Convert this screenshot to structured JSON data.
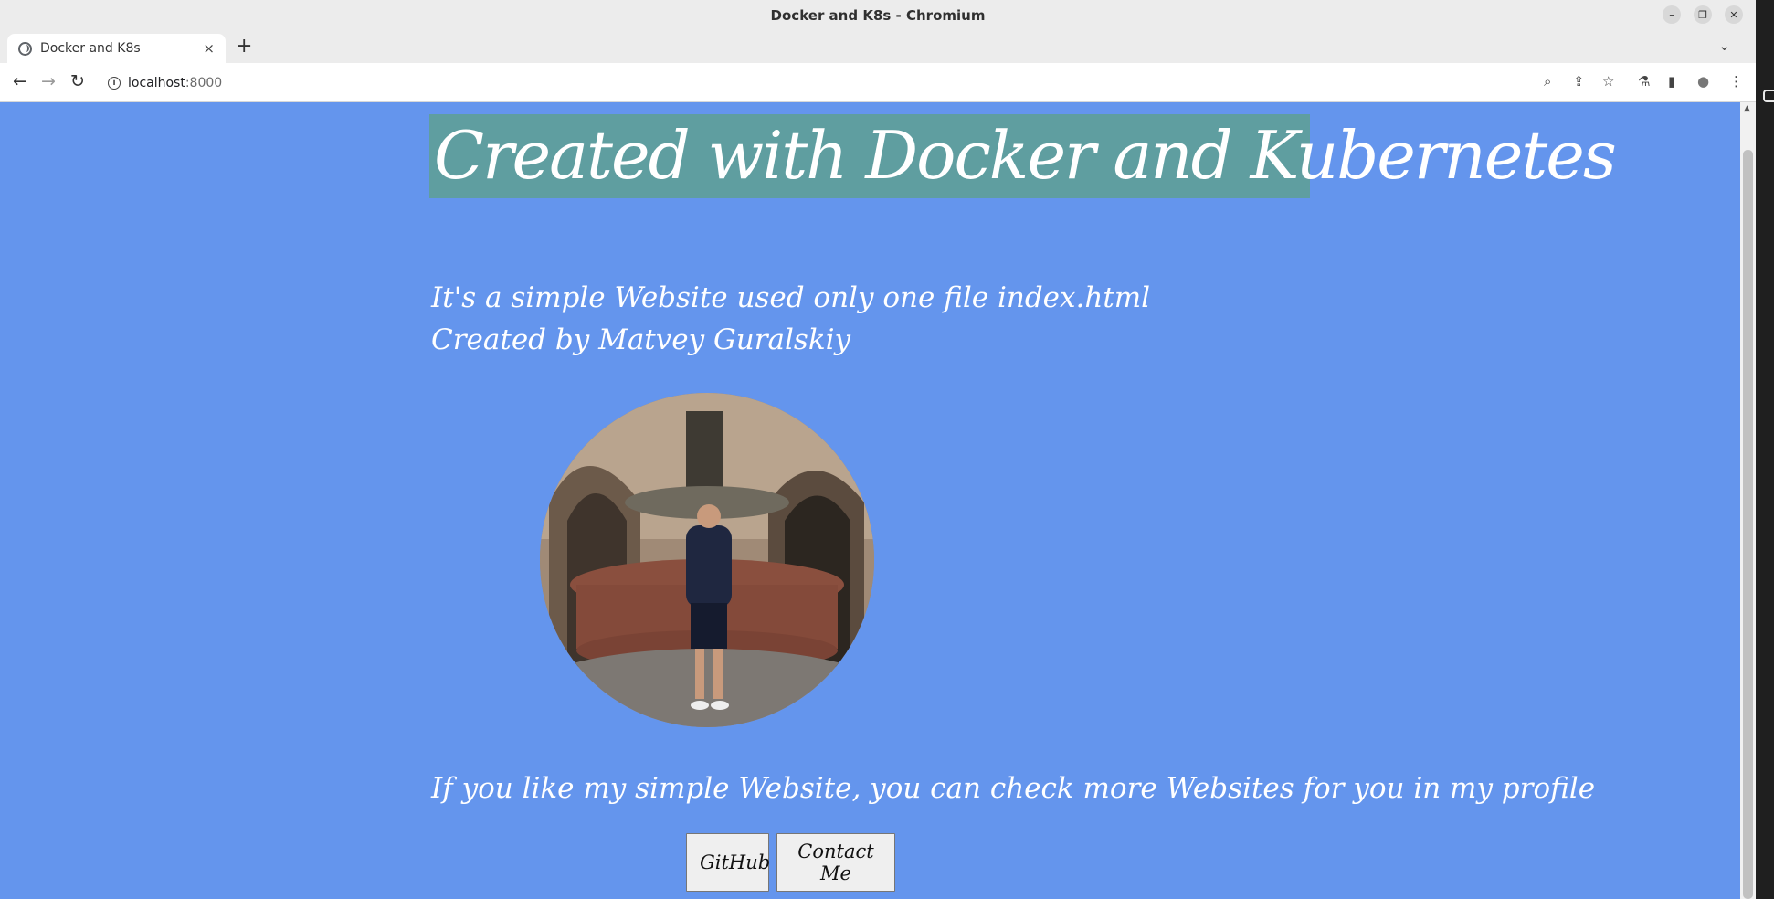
{
  "window": {
    "title": "Docker and K8s - Chromium",
    "controls": [
      "–",
      "❐",
      "✕"
    ]
  },
  "tabs": [
    {
      "title": "Docker and K8s",
      "close": "×"
    }
  ],
  "tabstrip": {
    "new_tab": "+",
    "tab_list": "⌄"
  },
  "toolbar": {
    "back": "←",
    "forward": "→",
    "reload": "↻",
    "url_host": "localhost",
    "url_port": ":8000",
    "info": "i",
    "zoom": "⌕",
    "share": "⇪",
    "bookmark": "☆",
    "labs": "⚗",
    "side_panel": "▮",
    "profile": "●",
    "menu": "⋮"
  },
  "page": {
    "headline": "Created with Docker and Kubernetes",
    "intro_line1": "It's a simple Website used only one file index.html",
    "intro_line2": "Created by Matvey Guralskiy",
    "profile_line": "If you like my simple Website, you can check more Websites for you in my profile",
    "buttons": {
      "github": "GitHub",
      "contact": "Contact Me"
    },
    "colors": {
      "background": "#6495ed",
      "headline_bg": "#5f9ea0",
      "text": "#ffffff"
    }
  },
  "scrollbar": {
    "up_arrow": "▲"
  }
}
